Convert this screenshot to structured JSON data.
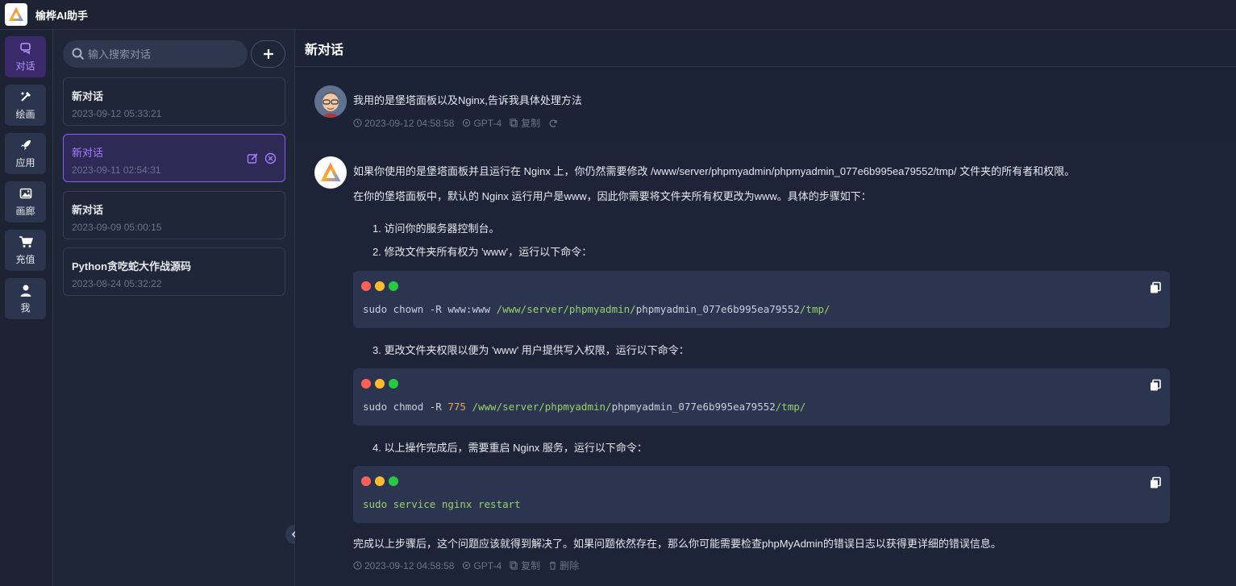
{
  "app": {
    "title": "榆桦AI助手"
  },
  "rail": [
    {
      "label": "对话",
      "icon": "chat-icon",
      "active": true
    },
    {
      "label": "绘画",
      "icon": "brush-icon",
      "active": false
    },
    {
      "label": "应用",
      "icon": "rocket-icon",
      "active": false
    },
    {
      "label": "画廊",
      "icon": "image-icon",
      "active": false
    },
    {
      "label": "充值",
      "icon": "cart-icon",
      "active": false
    },
    {
      "label": "我",
      "icon": "user-icon",
      "active": false
    }
  ],
  "search": {
    "placeholder": "输入搜索对话"
  },
  "conversations": [
    {
      "title": "新对话",
      "date": "2023-09-12 05:33:21",
      "active": false
    },
    {
      "title": "新对话",
      "date": "2023-09-11 02:54:31",
      "active": true
    },
    {
      "title": "新对话",
      "date": "2023-09-09 05:00:15",
      "active": false
    },
    {
      "title": "Python贪吃蛇大作战源码",
      "date": "2023-08-24 05:32:22",
      "active": false
    }
  ],
  "chat": {
    "title": "新对话",
    "user_message": {
      "text": "我用的是堡塔面板以及Nginx,告诉我具体处理方法",
      "time": "2023-09-12 04:58:58",
      "model": "GPT-4",
      "copy_label": "复制"
    },
    "ai_message": {
      "intro1": "如果你使用的是堡塔面板并且运行在 Nginx 上，你仍然需要修改 /www/server/phpmyadmin/phpmyadmin_077e6b995ea79552/tmp/ 文件夹的所有者和权限。",
      "intro2": "在你的堡塔面板中，默认的 Nginx 运行用户是www，因此你需要将文件夹所有权更改为www。具体的步骤如下：",
      "steps": [
        "1. 访问你的服务器控制台。",
        "2. 修改文件夹所有权为 'www'，运行以下命令：",
        "3. 更改文件夹权限以便为 'www' 用户提供写入权限，运行以下命令：",
        "4. 以上操作完成后，需要重启 Nginx 服务，运行以下命令："
      ],
      "code": [
        {
          "cmd": "sudo chown -R www:www ",
          "arg": "",
          "p1": "/www/server/",
          "p2": "phpmyadmin",
          "p3": "/",
          "p4": "phpmyadmin_077e6b995ea79552",
          "p5": "/tmp/"
        },
        {
          "cmd": "sudo chmod -R ",
          "arg": "775 ",
          "p1": "/www/server/",
          "p2": "phpmyadmin",
          "p3": "/",
          "p4": "phpmyadmin_077e6b995ea79552",
          "p5": "/tmp/"
        },
        {
          "line": "sudo service nginx restart"
        }
      ],
      "outro": "完成以上步骤后，这个问题应该就得到解决了。如果问题依然存在，那么你可能需要检查phpMyAdmin的错误日志以获得更详细的错误信息。",
      "time": "2023-09-12 04:58:58",
      "model": "GPT-4",
      "copy_label": "复制",
      "delete_label": "删除"
    }
  },
  "colors": {
    "accent": "#8a5cf5",
    "dot_red": "#ff5f56",
    "dot_yellow": "#ffbd2e",
    "dot_green": "#27c93f"
  }
}
